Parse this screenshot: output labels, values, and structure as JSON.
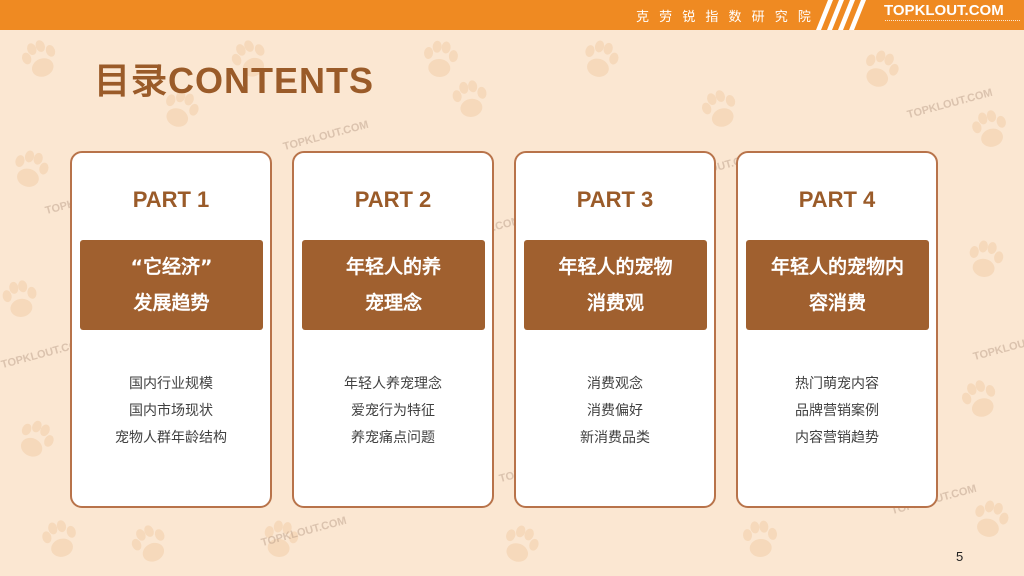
{
  "header": {
    "institute": "克 劳 锐 指 数 研 究 院",
    "brand": "TOPKLOUT.COM"
  },
  "title": "目录CONTENTS",
  "watermark": "TOPKLOUT.COM",
  "colors": {
    "bar": "#ef8a22",
    "accent": "#a0602f",
    "background": "#fbe7d2",
    "border": "#b8734a"
  },
  "cards": [
    {
      "part": "PART 1",
      "heading": [
        "“它经济”",
        "发展趋势"
      ],
      "items": [
        "国内行业规模",
        "国内市场现状",
        "宠物人群年龄结构"
      ]
    },
    {
      "part": "PART 2",
      "heading": [
        "年轻人的养",
        "宠理念"
      ],
      "items": [
        "年轻人养宠理念",
        "爱宠行为特征",
        "养宠痛点问题"
      ]
    },
    {
      "part": "PART 3",
      "heading": [
        "年轻人的宠物",
        "消费观"
      ],
      "items": [
        "消费观念",
        "消费偏好",
        "新消费品类"
      ]
    },
    {
      "part": "PART 4",
      "heading": [
        "年轻人的宠物内",
        "容消费"
      ],
      "items": [
        "热门萌宠内容",
        "品牌营销案例",
        "内容营销趋势"
      ]
    }
  ],
  "page_number": "5"
}
